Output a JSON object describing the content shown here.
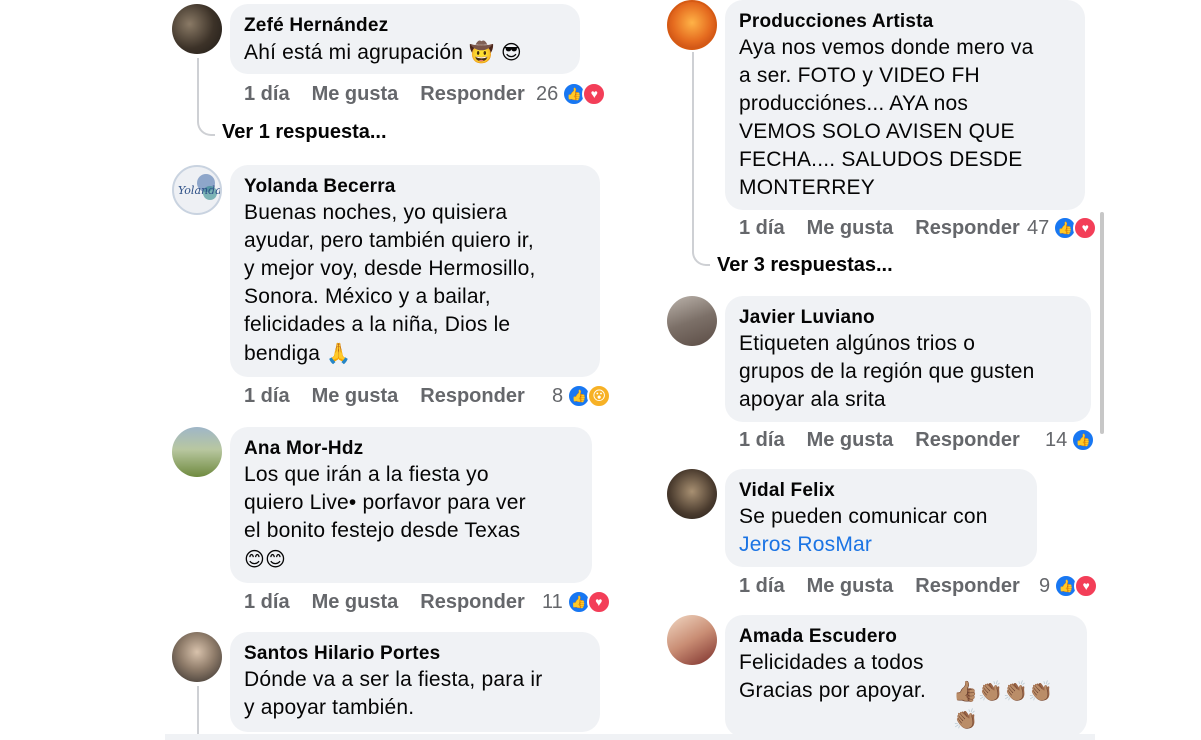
{
  "actions": {
    "time": "1 día",
    "like": "Me gusta",
    "reply": "Responder"
  },
  "left": {
    "comments": [
      {
        "author": "Zefé Hernández",
        "text": "Ahí está mi agrupación",
        "emoji": "🤠 😎",
        "count": "26",
        "reactions": [
          "like-icon",
          "love-icon"
        ],
        "replies_link": "Ver 1 respuesta..."
      },
      {
        "author": "Yolanda Becerra",
        "text": "Buenas noches, yo quisiera\nayudar, pero también quiero ir,\ny mejor voy, desde Hermosillo,\nSonora. México y a bailar,\nfelicidades a la niña, Dios le\nbendiga",
        "emoji": "🙏",
        "avatar_text": "Yolanda",
        "count": "8",
        "reactions": [
          "like-icon",
          "wow-icon"
        ]
      },
      {
        "author": "Ana Mor-Hdz",
        "text": "Los que irán a la fiesta yo\nquiero Live• porfavor para ver\nel bonito festejo desde Texas",
        "emoji": "😊😊",
        "count": "11",
        "reactions": [
          "like-icon",
          "love-icon"
        ]
      },
      {
        "author": "Santos Hilario Portes",
        "text": "Dónde va a ser la fiesta, para ir\ny apoyar también."
      }
    ]
  },
  "right": {
    "comments": [
      {
        "author": "Producciones Artista",
        "text": "Aya nos vemos donde mero va\na ser. FOTO y VIDEO FH\nproducciónes... AYA nos\nVEMOS SOLO AVISEN QUE\nFECHA.... SALUDOS DESDE\nMONTERREY",
        "count": "47",
        "reactions": [
          "like-icon",
          "love-icon"
        ],
        "replies_link": "Ver 3 respuestas..."
      },
      {
        "author": "Javier Luviano",
        "text": "Etiqueten algúnos trios o\ngrupos de la región que gusten\napoyar ala srita",
        "count": "14",
        "reactions": [
          "like-icon"
        ]
      },
      {
        "author": "Vidal Felix",
        "text": "Se pueden comunicar con",
        "mention": "Jeros RosMar",
        "count": "9",
        "reactions": [
          "like-icon",
          "love-icon"
        ]
      },
      {
        "author": "Amada Escudero",
        "text": "Felicidades a todos\nGracias por apoyar.",
        "emoji": "👍🏽👏🏽👏🏽👏🏽\n👏🏽"
      }
    ]
  }
}
